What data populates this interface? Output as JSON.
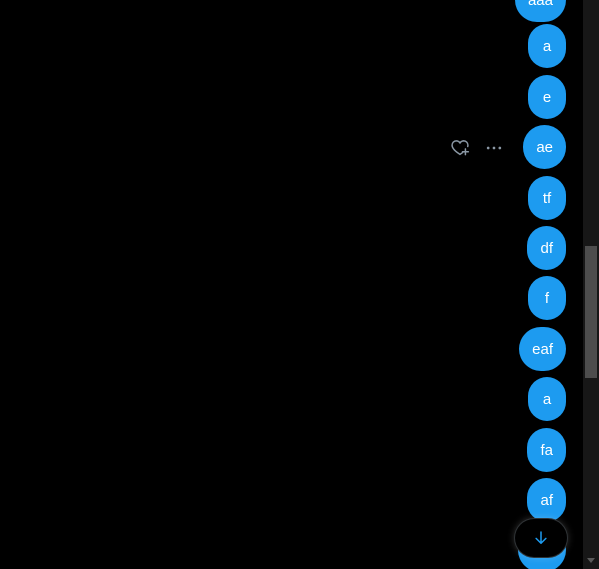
{
  "messages": [
    {
      "text": "aaa"
    },
    {
      "text": "a"
    },
    {
      "text": "e"
    },
    {
      "text": "ae"
    },
    {
      "text": "tf"
    },
    {
      "text": "df"
    },
    {
      "text": "f"
    },
    {
      "text": "eaf"
    },
    {
      "text": "a"
    },
    {
      "text": "fa"
    },
    {
      "text": "af"
    },
    {
      "text": ""
    }
  ],
  "hovered_message_actions": {
    "icons": [
      "heart-plus-icon",
      "more-horizontal-icon"
    ]
  },
  "scroll_down_button": {
    "icon": "arrow-down-icon"
  },
  "colors": {
    "background": "#000000",
    "bubble": "#1d9bf0",
    "bubble_text": "#ffffff",
    "icon_muted": "#8b98a5",
    "accent": "#1d9bf0"
  }
}
